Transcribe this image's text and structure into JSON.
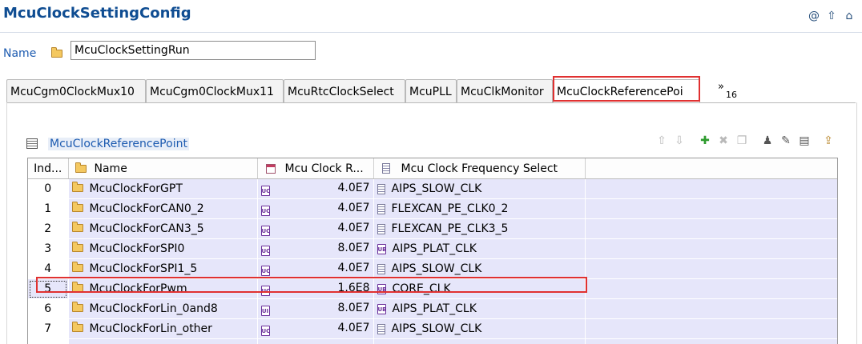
{
  "header": {
    "title": "McuClockSettingConfig",
    "icons": [
      "at-icon",
      "up-arrow-icon",
      "home-icon"
    ]
  },
  "name_field": {
    "label": "Name",
    "value": "McuClockSettingRun"
  },
  "tabs": {
    "items": [
      {
        "label": "McuCgm0ClockMux10",
        "active": false
      },
      {
        "label": "McuCgm0ClockMux11",
        "active": false
      },
      {
        "label": "McuRtcClockSelect",
        "active": false
      },
      {
        "label": "McuPLL",
        "active": false
      },
      {
        "label": "McuClkMonitor",
        "active": false
      },
      {
        "label": "McuClockReferencePoi",
        "active": true
      }
    ],
    "overflow_symbol": "»",
    "overflow_count": "16"
  },
  "section": {
    "title": "McuClockReferencePoint"
  },
  "toolbar": {
    "buttons": [
      "move-up",
      "move-down",
      "add",
      "delete",
      "copy",
      "user",
      "edit",
      "properties",
      "export"
    ]
  },
  "table": {
    "columns": [
      "Ind...",
      "Name",
      "Mcu Clock R...",
      "Mcu Clock Frequency Select"
    ],
    "rows": [
      {
        "index": "0",
        "name": "McuClockForGPT",
        "freq": "4.0E7",
        "select": "AIPS_SLOW_CLK"
      },
      {
        "index": "1",
        "name": "McuClockForCAN0_2",
        "freq": "4.0E7",
        "select": "FLEXCAN_PE_CLK0_2"
      },
      {
        "index": "2",
        "name": "McuClockForCAN3_5",
        "freq": "4.0E7",
        "select": "FLEXCAN_PE_CLK3_5"
      },
      {
        "index": "3",
        "name": "McuClockForSPI0",
        "freq": "8.0E7",
        "select": "AIPS_PLAT_CLK"
      },
      {
        "index": "4",
        "name": "McuClockForSPI1_5",
        "freq": "4.0E7",
        "select": "AIPS_SLOW_CLK"
      },
      {
        "index": "5",
        "name": "McuClockForPwm",
        "freq": "1.6E8",
        "select": "CORE_CLK"
      },
      {
        "index": "6",
        "name": "McuClockForLin_0and8",
        "freq": "8.0E7",
        "select": "AIPS_PLAT_CLK"
      },
      {
        "index": "7",
        "name": "McuClockForLin_other",
        "freq": "4.0E7",
        "select": "AIPS_SLOW_CLK"
      }
    ],
    "selected_index": "5"
  },
  "colors": {
    "title": "#0f4d92",
    "link": "#1d5bb0",
    "row_bg": "#e6e6fa",
    "highlight": "#e03131"
  }
}
